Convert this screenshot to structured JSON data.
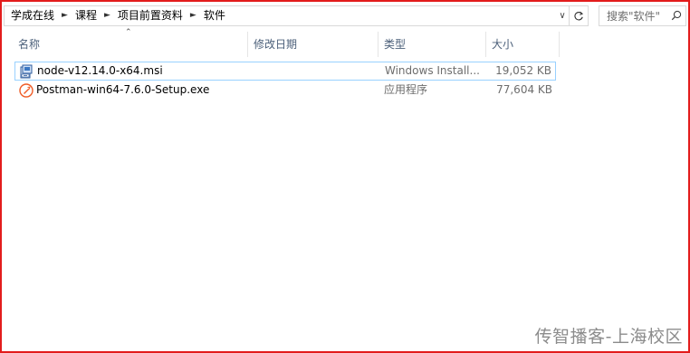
{
  "breadcrumb": {
    "items": [
      "学成在线",
      "课程",
      "项目前置资料",
      "软件"
    ]
  },
  "search": {
    "placeholder": "搜索\"软件\""
  },
  "columns": {
    "name": "名称",
    "modified": "修改日期",
    "type": "类型",
    "size": "大小"
  },
  "files": [
    {
      "name": "node-v12.14.0-x64.msi",
      "type": "Windows Install...",
      "size": "19,052 KB",
      "icon": "msi-installer-icon",
      "selected": true
    },
    {
      "name": "Postman-win64-7.6.0-Setup.exe",
      "type": "应用程序",
      "size": "77,604 KB",
      "icon": "postman-app-icon",
      "selected": false
    }
  ],
  "watermark": "传智播客-上海校区",
  "colors": {
    "frame_border": "#e31c1c",
    "header_text": "#4c607a",
    "selection_border": "#99d1ff",
    "secondary_text": "#6d6d6d",
    "postman_orange": "#ef5b25"
  }
}
